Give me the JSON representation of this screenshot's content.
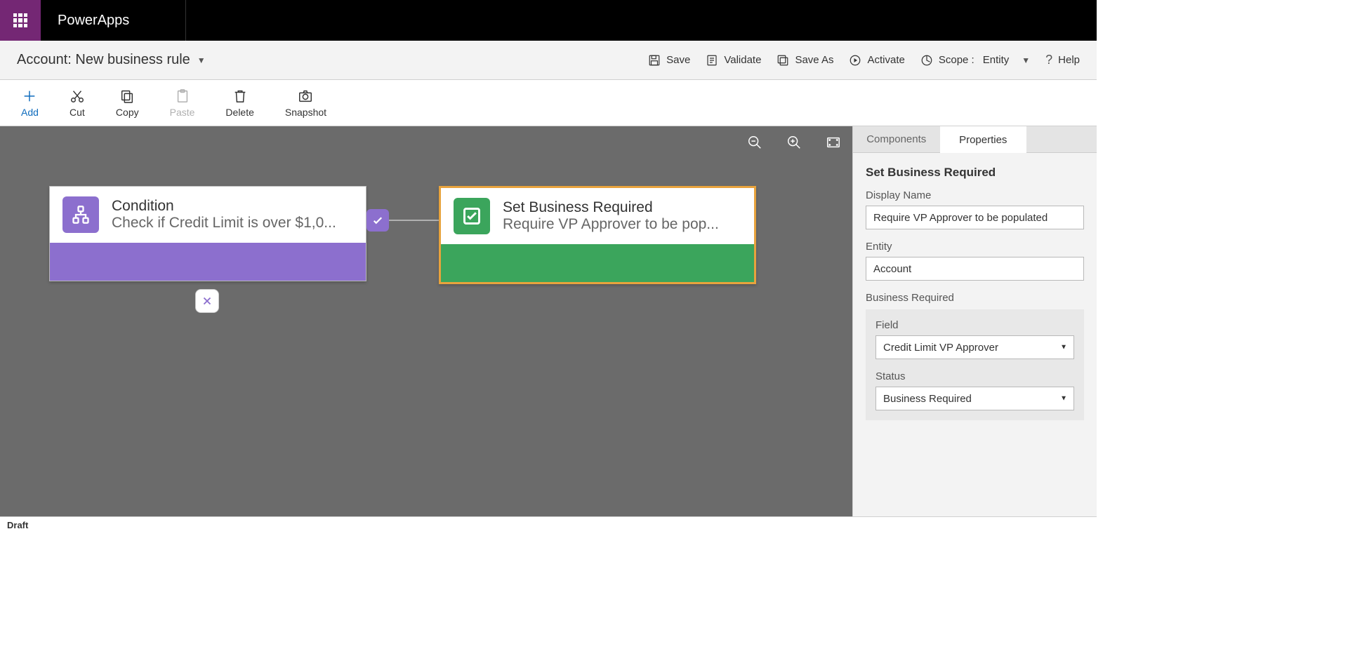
{
  "brand": "PowerApps",
  "ruleTitle": "Account: New business rule",
  "headerActions": {
    "save": "Save",
    "validate": "Validate",
    "saveAs": "Save As",
    "activate": "Activate",
    "scopeLabel": "Scope :",
    "scopeValue": "Entity",
    "help": "Help"
  },
  "toolbar": {
    "add": "Add",
    "cut": "Cut",
    "copy": "Copy",
    "paste": "Paste",
    "delete": "Delete",
    "snapshot": "Snapshot"
  },
  "canvas": {
    "conditionTitle": "Condition",
    "conditionSub": "Check if Credit Limit is over $1,0...",
    "actionTitle": "Set Business Required",
    "actionSub": "Require VP Approver to be pop..."
  },
  "side": {
    "tabComponents": "Components",
    "tabProperties": "Properties",
    "heading": "Set Business Required",
    "displayNameLabel": "Display Name",
    "displayNameValue": "Require VP Approver to be populated",
    "entityLabel": "Entity",
    "entityValue": "Account",
    "sectionLabel": "Business Required",
    "fieldLabel": "Field",
    "fieldValue": "Credit Limit VP Approver",
    "statusLabel": "Status",
    "statusValue": "Business Required"
  },
  "status": "Draft"
}
